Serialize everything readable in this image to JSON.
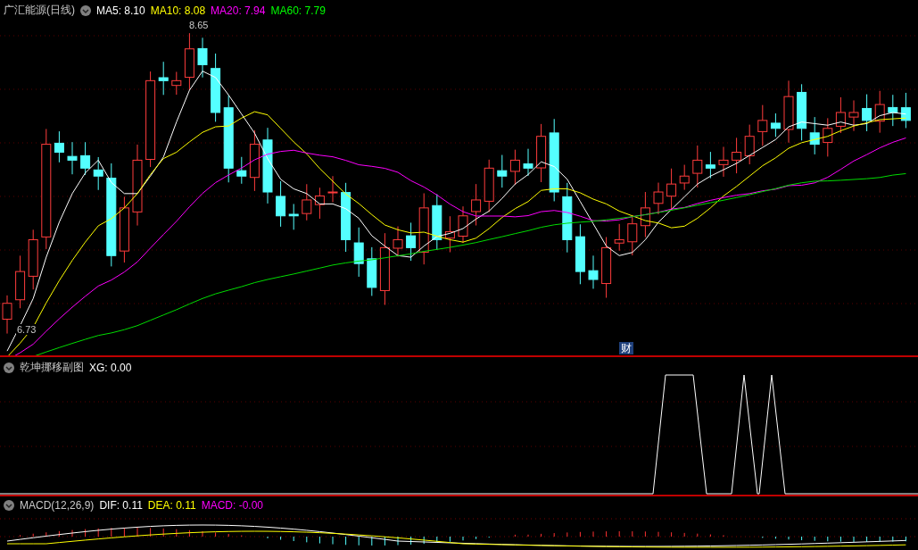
{
  "main_chart": {
    "title": "广汇能源(日线)",
    "indicators": [
      {
        "label": "MA5: 8.10",
        "color": "#ffffff"
      },
      {
        "label": "MA10: 8.08",
        "color": "#ffff00"
      },
      {
        "label": "MA20: 7.94",
        "color": "#ff00ff"
      },
      {
        "label": "MA60: 7.79",
        "color": "#00ff00"
      }
    ],
    "high_label": "8.65",
    "low_label": "6.73",
    "event_badge": "财"
  },
  "sub_chart": {
    "title": "乾坤挪移副图",
    "indicators": [
      {
        "label": "XG: 0.00",
        "color": "#ffffff"
      }
    ]
  },
  "macd_chart": {
    "title": "MACD(12,26,9)",
    "indicators": [
      {
        "label": "DIF: 0.11",
        "color": "#ffffff"
      },
      {
        "label": "DEA: 0.11",
        "color": "#ffff00"
      },
      {
        "label": "MACD: -0.00",
        "color": "#ff00ff"
      }
    ]
  }
}
